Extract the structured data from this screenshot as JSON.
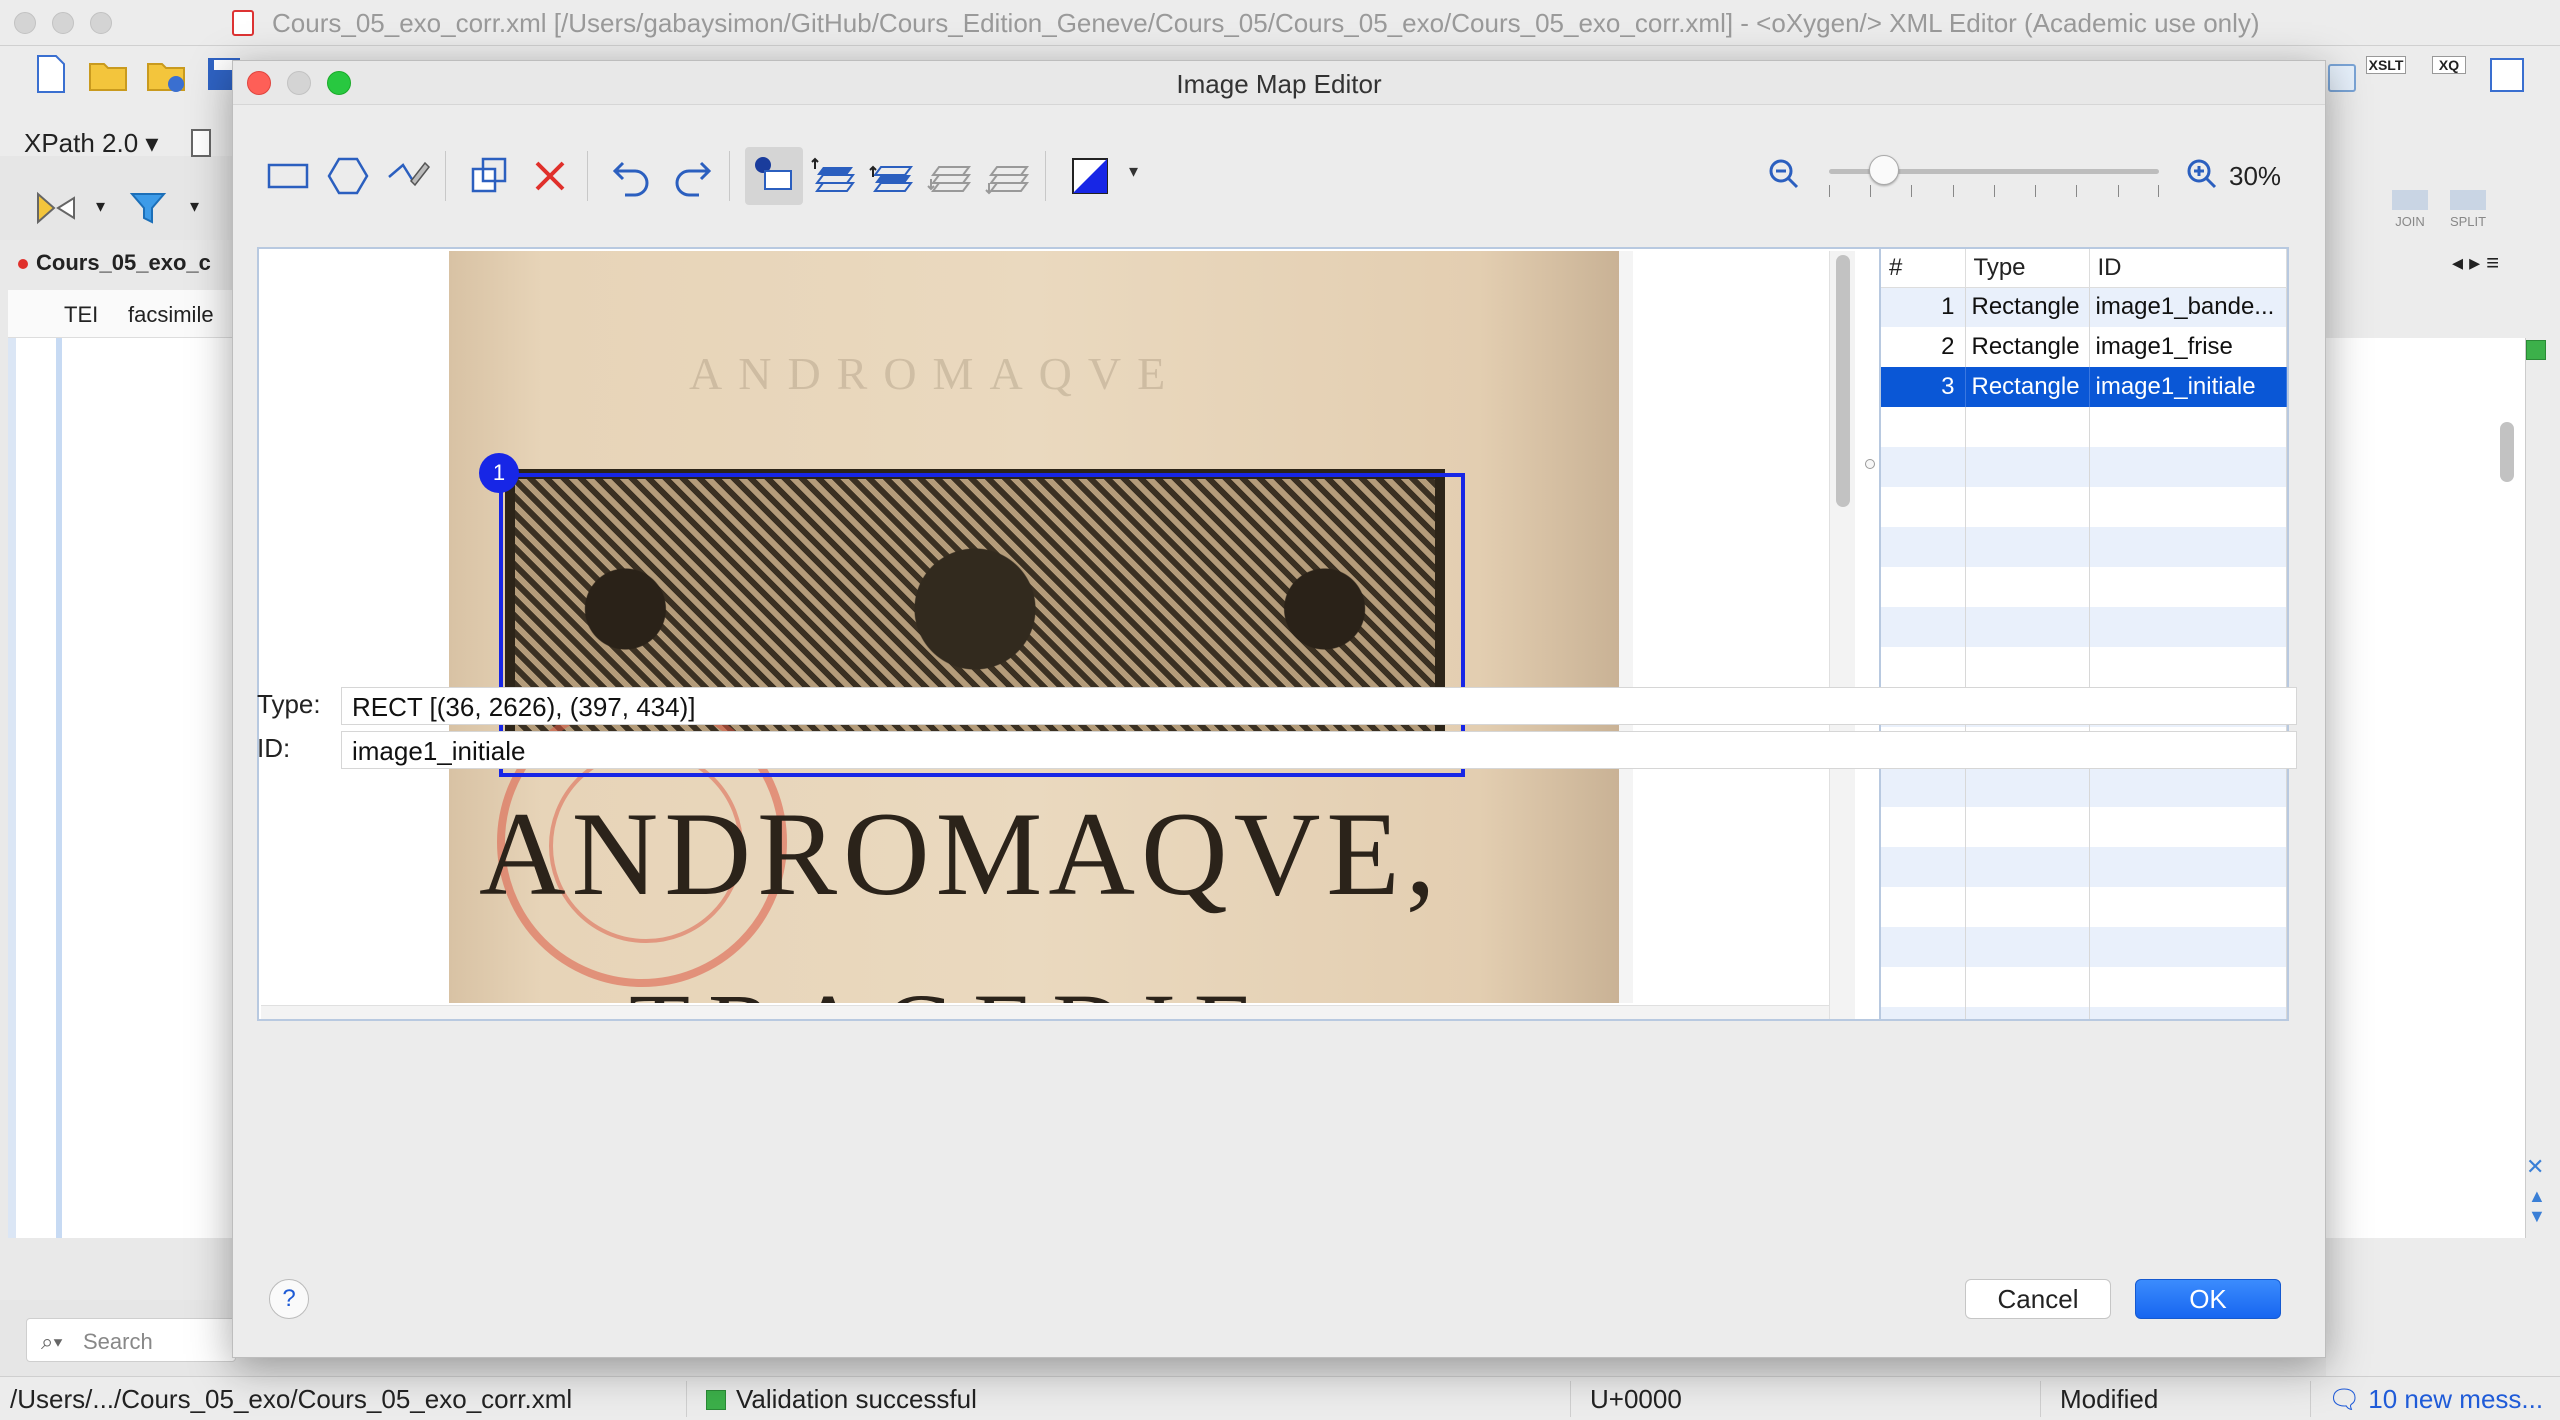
{
  "window": {
    "title": "Cours_05_exo_corr.xml [/Users/gabaysimon/GitHub/Cours_Edition_Geneve/Cours_05/Cours_05_exo/Cours_05_exo_corr.xml] - <oXygen/> XML Editor (Academic use only)"
  },
  "toolbar": {
    "xpath_label": "XPath 2.0",
    "xslt_label": "XSLT",
    "xq_label": "XQ",
    "join_label": "JOIN",
    "split_label": "SPLIT"
  },
  "editor": {
    "file_tab": "Cours_05_exo_c",
    "breadcrumb": [
      "TEI",
      "facsimile"
    ]
  },
  "search": {
    "placeholder": "Search"
  },
  "status": {
    "path": "/Users/.../Cours_05_exo/Cours_05_exo_corr.xml",
    "validation": "Validation successful",
    "unicode": "U+0000",
    "modified": "Modified",
    "messages": "10 new mess..."
  },
  "dialog": {
    "title": "Image Map Editor",
    "zoom_value": 0.3,
    "zoom_label": "30%",
    "image_text": {
      "title": "ANDROMAQVE,",
      "subtitle": "TRAGEDIE",
      "header_ghost": "ANDROMAQVE"
    },
    "selection_badge": "1",
    "table": {
      "headers": [
        "#",
        "Type",
        "ID"
      ],
      "rows": [
        {
          "num": "1",
          "type": "Rectangle",
          "id": "image1_bande..."
        },
        {
          "num": "2",
          "type": "Rectangle",
          "id": "image1_frise"
        },
        {
          "num": "3",
          "type": "Rectangle",
          "id": "image1_initiale"
        }
      ],
      "selected_index": 2
    },
    "type_label": "Type:",
    "type_value": "RECT [(36, 2626), (397, 434)]",
    "id_label": "ID:",
    "id_value": "image1_initiale",
    "cancel_label": "Cancel",
    "ok_label": "OK",
    "help_label": "?"
  },
  "colors": {
    "accent": "#0a57d6",
    "selection": "#1726e6",
    "ok_button": "#1f6ff5",
    "close_light": "#fe5f57",
    "zoom_light": "#28c840",
    "validation_ok": "#3cb04a"
  }
}
